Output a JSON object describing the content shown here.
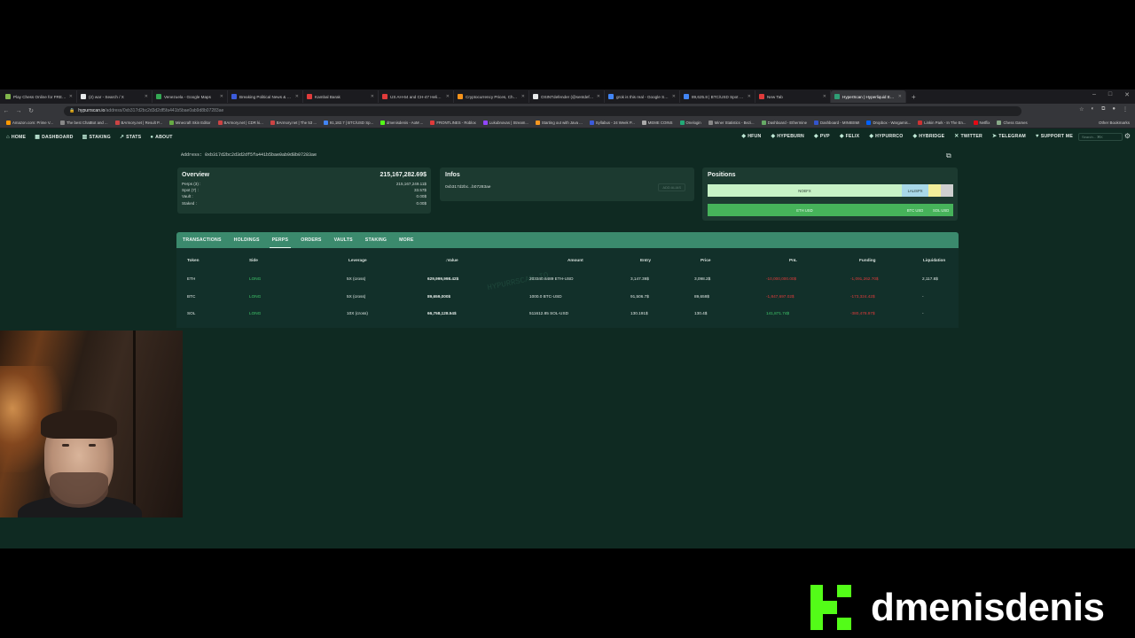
{
  "browser": {
    "tabs": [
      {
        "title": "Play Chess Online for FREE - 2...",
        "color": "#81b64c"
      },
      {
        "title": "(2) war - Search / X",
        "color": "#e7e9ea"
      },
      {
        "title": "Venezuela - Google Maps",
        "color": "#34a853"
      },
      {
        "title": "Breaking Political News & Predi...",
        "color": "#3b5bdb"
      },
      {
        "title": "Kambal Barak",
        "color": "#e03b3b"
      },
      {
        "title": "US AH-64 and CH-47 Helicopte...",
        "color": "#e03b3b"
      },
      {
        "title": "Cryptocurrency Prices, Charts A...",
        "color": "#f7931a"
      },
      {
        "title": "OSINTdefender (@sentdefe...",
        "color": "#e7e9ea"
      },
      {
        "title": "grok is this real - Google Search",
        "color": "#4285f4"
      },
      {
        "title": "89,625.8 | BTC/USD Spot Tradin...",
        "color": "#4285f4"
      },
      {
        "title": "New Tab",
        "color": "#e03b3b"
      },
      {
        "title": "HyperScan | Hyperliquid Explo...",
        "color": "#2f9e75"
      }
    ],
    "url_host": "hypurrscan.io",
    "url_path": "/address/0xb317d2bc2d3d2df5fa441b5bae0ab9d8b07283ae",
    "bookmarks": [
      "Amazon.com: Prime V...",
      "The best ChatBot and ...",
      "BArmory.net | Result P...",
      "Minecraft Skin Editor",
      "BArmory.net | CDR ki...",
      "BArmory.net | The 53 ...",
      "91,182.7 | BTC/USD Sp...",
      "dmenisdenis - AoM ...",
      "FRONTLINES - Roblox",
      "Lukubnovas | Stream...",
      "Starting out with Java ...",
      "Syllabus - 24 Week P...",
      "MEME COINS",
      "Onelogin",
      "Miner Statistics - Bezi...",
      "Dashboard - Ethermine",
      "Dashboard - MINIBSMI",
      "Dropbox - Wargamis...",
      "Linkin Park - In The En...",
      "Netflix",
      "Chess Games"
    ],
    "other_bookmarks": "Other Bookmarks",
    "win_controls": [
      "–",
      "□",
      "✕"
    ]
  },
  "nav": {
    "left": [
      {
        "icon": "⌂",
        "label": "HOME"
      },
      {
        "icon": "▦",
        "label": "DASHBOARD"
      },
      {
        "icon": "▥",
        "label": "STAKING"
      },
      {
        "icon": "↗",
        "label": "STATS"
      },
      {
        "icon": "●",
        "label": "ABOUT"
      }
    ],
    "right": [
      {
        "icon": "◆",
        "label": "HFUN"
      },
      {
        "icon": "◆",
        "label": "HYPEBURN"
      },
      {
        "icon": "◆",
        "label": "PVP"
      },
      {
        "icon": "◆",
        "label": "FELIX"
      },
      {
        "icon": "◆",
        "label": "HYPURRCO"
      },
      {
        "icon": "◆",
        "label": "HYBRIDGE"
      },
      {
        "icon": "✕",
        "label": "TWITTER"
      },
      {
        "icon": "➤",
        "label": "TELEGRAM"
      },
      {
        "icon": "♥",
        "label": "SUPPORT ME"
      }
    ],
    "search_placeholder": "Search...    ⌘K"
  },
  "address_label": "Address: 0xb317d2bc2d3d2df5fa441b5bae0ab9d8b07283ae",
  "overview": {
    "title": "Overview",
    "total": "215,167,282.69$",
    "rows": [
      {
        "label": "Perps (3) :",
        "value": "215,167,249.11$"
      },
      {
        "label": "Spot (7) :",
        "value": "33.57$"
      },
      {
        "label": "Vault :",
        "value": "0.00$"
      },
      {
        "label": "Staked :",
        "value": "0.00$"
      }
    ]
  },
  "infos": {
    "title": "Infos",
    "address_short": "0xb317d2bc...b07283ae",
    "alias_button": "ADD ALIAS"
  },
  "positions": {
    "title": "Positions",
    "bar1": [
      {
        "label": "NOEFX",
        "share": 0.79,
        "color": "#c7f2c6"
      },
      {
        "label": "LALISPX",
        "share": 0.11,
        "color": "#a8d8e8"
      },
      {
        "label": "",
        "share": 0.05,
        "color": "#f2ee9a"
      },
      {
        "label": "",
        "share": 0.05,
        "color": "#cfcfcf"
      }
    ],
    "bar2": [
      {
        "label": "ETH USD",
        "share": 0.79
      },
      {
        "label": "BTC USD",
        "share": 0.11
      },
      {
        "label": "SOL USD",
        "share": 0.1
      }
    ],
    "bar2_color": "#46b35a"
  },
  "tabs": [
    "TRANSACTIONS",
    "HOLDINGS",
    "PERPS",
    "ORDERS",
    "VAULTS",
    "STAKING",
    "MORE"
  ],
  "active_tab": "PERPS",
  "table": {
    "headers": {
      "token": "Token",
      "side": "Side",
      "leverage": "Leverage",
      "value": "Value",
      "amount": "Amount",
      "entry": "Entry",
      "price": "Price",
      "pnl": "PnL",
      "funding": "Funding",
      "liquidation": "Liquidation"
    },
    "sort_icon": "↓",
    "rows": [
      {
        "token": "ETH",
        "side": "LONG",
        "leverage": "5X (cross)",
        "value": "629,999,998.42$",
        "amount": "203340.6489 ETH-USD",
        "entry": "3,147.39$",
        "price": "3,098.2$",
        "pnl": "-10,000,000.00$",
        "funding": "-1,091,262.70$",
        "liquidation": "2,117.8$"
      },
      {
        "token": "BTC",
        "side": "LONG",
        "leverage": "5X (cross)",
        "value": "89,659,000$",
        "amount": "1000.0 BTC-USD",
        "entry": "91,506.7$",
        "price": "89,659$",
        "pnl": "-1,847,697.02$",
        "funding": "-173,324.42$",
        "liquidation": "-"
      },
      {
        "token": "SOL",
        "side": "LONG",
        "leverage": "10X (cross)",
        "value": "66,758,128.54$",
        "amount": "511612.85 SOL-USD",
        "entry": "130.191$",
        "price": "130.4$",
        "pnl": "141,871.74$",
        "funding": "-380,478.97$",
        "liquidation": "-"
      }
    ],
    "watermark": "HYPURRSCAN.IO"
  },
  "brand": "dmenisdenis"
}
